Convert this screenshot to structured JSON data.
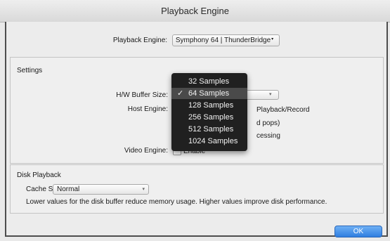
{
  "window": {
    "title": "Playback Engine"
  },
  "playback_engine": {
    "label": "Playback Engine:",
    "value": "Symphony 64 | ThunderBridge"
  },
  "settings": {
    "title": "Settings",
    "hw_buffer_label": "H/W Buffer Size:",
    "host_engine_label": "Host Engine:",
    "video_engine_label": "Video Engine:",
    "fragments": {
      "playback_record": "Playback/Record",
      "pops": "d pops)",
      "processing": "cessing",
      "enable": "Enable"
    }
  },
  "buffer_menu": {
    "items": [
      {
        "label": "32 Samples",
        "checked": false
      },
      {
        "label": "64 Samples",
        "checked": true
      },
      {
        "label": "128 Samples",
        "checked": false
      },
      {
        "label": "256 Samples",
        "checked": false
      },
      {
        "label": "512 Samples",
        "checked": false
      },
      {
        "label": "1024 Samples",
        "checked": false
      }
    ],
    "check_glyph": "✓"
  },
  "disk_playback": {
    "title": "Disk Playback",
    "cache_label": "Cache Size:",
    "cache_value": "Normal",
    "hint": "Lower values for the disk buffer reduce memory usage.  Higher values improve disk performance."
  },
  "ok_button": {
    "label": "OK"
  },
  "colors": {
    "accent": "#2f7ee0",
    "menu_bg": "#202020",
    "menu_highlight": "#4a4a4a"
  }
}
